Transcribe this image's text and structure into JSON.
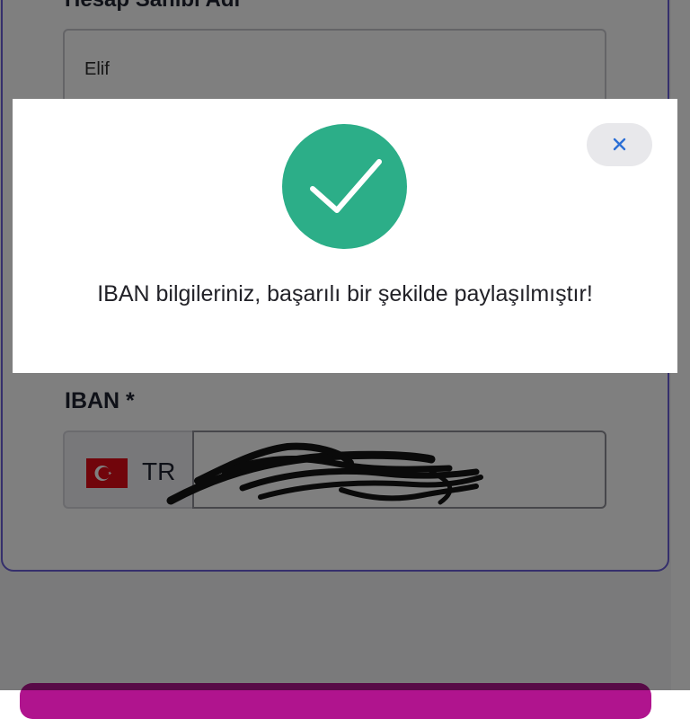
{
  "form": {
    "holder_label": "Hesap Sahibi Adı",
    "holder_value": "Elif",
    "iban_label": "IBAN *",
    "iban_prefix": "TR",
    "iban_value": ""
  },
  "modal": {
    "message": "IBAN bilgileriniz, başarılı bir şekilde paylaşılmıştır!",
    "close_label": "×"
  },
  "icons": {
    "success": "check-circle-icon",
    "close": "close-icon",
    "flag": "turkey-flag-icon"
  },
  "colors": {
    "success": "#2cae88",
    "card_border": "#6a5fd8",
    "close_icon": "#2b6fd6",
    "primary_button": "#b0148e"
  }
}
